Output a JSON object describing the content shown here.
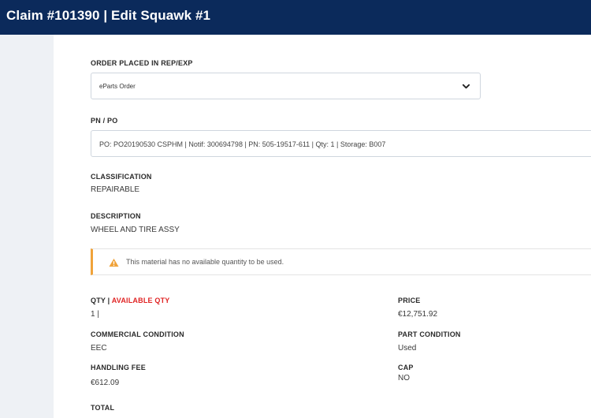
{
  "header": {
    "title": "Claim #101390 | Edit Squawk #1"
  },
  "order_placed": {
    "label": "ORDER PLACED IN REP/EXP",
    "selected": "eParts Order"
  },
  "pn_po": {
    "label": "PN / PO",
    "value": "PO: PO20190530 CSPHM | Notif: 300694798 | PN: 505-19517-611 | Qty: 1 | Storage: B007"
  },
  "classification": {
    "label": "CLASSIFICATION",
    "value": "REPAIRABLE"
  },
  "description": {
    "label": "DESCRIPTION",
    "value": "WHEEL AND TIRE ASSY"
  },
  "alert": {
    "message": "This material has no available quantity to be used.",
    "accent_color": "#f0a33a"
  },
  "qty": {
    "label_prefix": "QTY",
    "label_separator": " | ",
    "label_available": "AVAILABLE QTY",
    "value": "1 |"
  },
  "price": {
    "label": "PRICE",
    "value": "€12,751.92"
  },
  "commercial_condition": {
    "label": "COMMERCIAL CONDITION",
    "value": "EEC"
  },
  "part_condition": {
    "label": "PART CONDITION",
    "value": "Used"
  },
  "handling_fee": {
    "label": "HANDLING FEE",
    "value": "€612.09"
  },
  "cap": {
    "label": "CAP",
    "value": "NO"
  },
  "total": {
    "label": "TOTAL"
  },
  "colors": {
    "header_bg": "#0b2a5b",
    "warning": "#f0a33a",
    "available_qty": "#e02424"
  }
}
